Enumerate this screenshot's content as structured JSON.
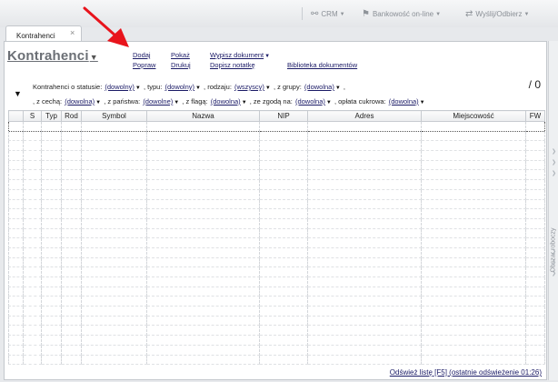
{
  "toolbar": {
    "crm": "CRM",
    "banking": "Bankowość on-line",
    "send": "Wyślij/Odbierz"
  },
  "tab": {
    "label": "Kontrahenci",
    "close": "×"
  },
  "page": {
    "title": "Kontrahenci",
    "count": "/ 0"
  },
  "actions": {
    "add": "Dodaj",
    "show": "Pokaż",
    "issue_document": "Wypisz dokument",
    "edit": "Popraw",
    "print": "Drukuj",
    "add_note": "Dopisz notatkę",
    "library": "Biblioteka dokumentów"
  },
  "filters": {
    "status_label": "Kontrahenci o statusie:",
    "status_value": "(dowolny)",
    "type_label": ", typu:",
    "type_value": "(dowolny)",
    "kind_label": ", rodzaju:",
    "kind_value": "(wszyscy)",
    "group_label": ", z grupy:",
    "group_value": "(dowolna)",
    "feature_label": ", z cechą:",
    "feature_value": "(dowolna)",
    "country_label": ", z państwa:",
    "country_value": "(dowolne)",
    "flag_label": ", z flagą:",
    "flag_value": "(dowolna)",
    "consent_label": ", ze zgodą na:",
    "consent_value": "(dowolna)",
    "sugar_label": ", opłata cukrowa:",
    "sugar_value": "(dowolna)"
  },
  "grid": {
    "columns": [
      "",
      "S",
      "Typ",
      "Rod",
      "Symbol",
      "Nazwa",
      "NIP",
      "Adres",
      "Miejscowość",
      "FW"
    ]
  },
  "footer": {
    "refresh": "Odśwież listę [F5] (ostatnie odświeżenie 01:26)"
  },
  "side_panel": {
    "label": "Obszar roboczy"
  },
  "colors": {
    "link": "#1a1a66",
    "annotation_arrow": "#e8141c",
    "title": "#6b6f75"
  }
}
